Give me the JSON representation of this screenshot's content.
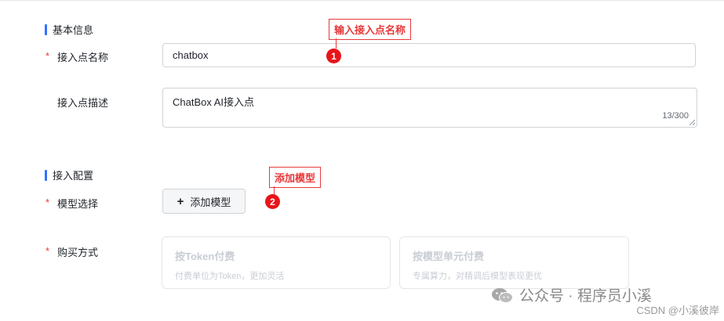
{
  "sections": {
    "basic": "基本信息",
    "access": "接入配置"
  },
  "fields": {
    "name_label": "接入点名称",
    "name_value": "chatbox",
    "desc_label": "接入点描述",
    "desc_value": "ChatBox AI接入点",
    "desc_counter": "13/300",
    "model_label": "模型选择",
    "add_model_button": "添加模型",
    "purchase_label": "购买方式",
    "required_mark": "*"
  },
  "purchase_options": [
    {
      "title": "按Token付费",
      "desc": "付费单位为Token，更加灵活"
    },
    {
      "title": "按模型单元付费",
      "desc": "专属算力，对精调后模型表现更优"
    }
  ],
  "annotations": [
    {
      "text": "输入接入点名称",
      "badge": "1"
    },
    {
      "text": "添加模型",
      "badge": "2"
    }
  ],
  "watermarks": {
    "wechat": "公众号 · 程序员小溪",
    "csdn": "CSDN @小溪彼岸"
  },
  "colors": {
    "accent": "#3370ff",
    "required": "#e8393a",
    "annotation": "#e8141a",
    "disabled_text": "#c9cdd4"
  }
}
